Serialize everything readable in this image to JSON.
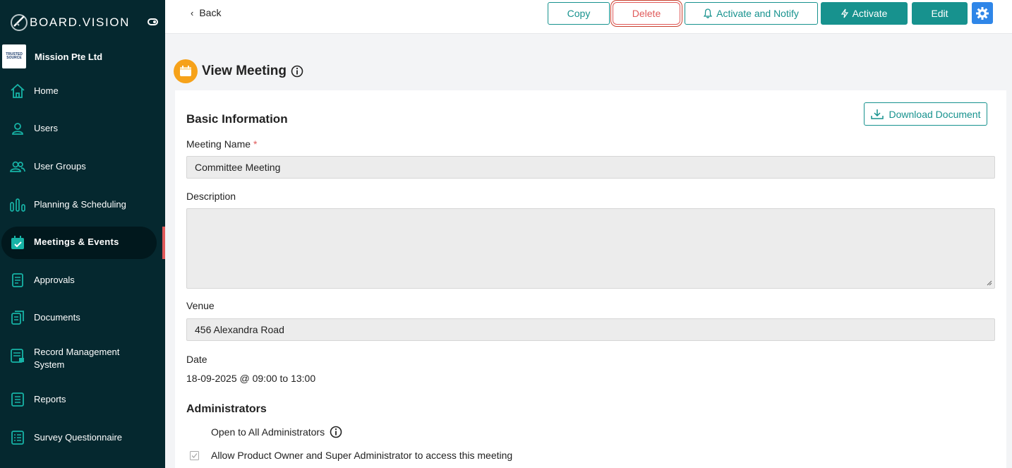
{
  "sidebar": {
    "brand": "BOARD.VISION",
    "org_logo_text": "TRUSTED SOURCE",
    "org_name": "Mission Pte Ltd",
    "items": [
      {
        "label": "Home",
        "icon": "home-icon"
      },
      {
        "label": "Users",
        "icon": "user-icon"
      },
      {
        "label": "User Groups",
        "icon": "user-group-icon"
      },
      {
        "label": "Planning & Scheduling",
        "icon": "bar-chart-icon"
      },
      {
        "label": "Meetings & Events",
        "icon": "calendar-check-icon",
        "active": true
      },
      {
        "label": "Approvals",
        "icon": "document-list-icon"
      },
      {
        "label": "Documents",
        "icon": "documents-icon"
      },
      {
        "label": "Record Management System",
        "icon": "record-icon"
      },
      {
        "label": "Reports",
        "icon": "report-list-icon"
      },
      {
        "label": "Survey Questionnaire",
        "icon": "survey-icon"
      }
    ]
  },
  "toolbar": {
    "back_label": "Back",
    "copy_label": "Copy",
    "delete_label": "Delete",
    "activate_notify_label": "Activate and Notify",
    "activate_label": "Activate",
    "edit_label": "Edit"
  },
  "page": {
    "title": "View Meeting"
  },
  "basic_info": {
    "section_title": "Basic Information",
    "download_label": "Download Document",
    "meeting_name_label": "Meeting Name",
    "required_mark": "*",
    "meeting_name_value": "Committee Meeting",
    "description_label": "Description",
    "description_value": "",
    "venue_label": "Venue",
    "venue_value": "456 Alexandra Road",
    "date_label": "Date",
    "date_value": "18-09-2025 @ 09:00 to 13:00"
  },
  "administrators": {
    "section_title": "Administrators",
    "open_to_all_label": "Open to All Administrators",
    "allow_owner_label": "Allow Product Owner and Super Administrator to access this meeting"
  },
  "colors": {
    "sidebar_bg": "#05282f",
    "accent": "#17928e",
    "danger": "#e05a5a",
    "gear_bg": "#2f86e8",
    "badge_orange": "#f6a21a"
  }
}
